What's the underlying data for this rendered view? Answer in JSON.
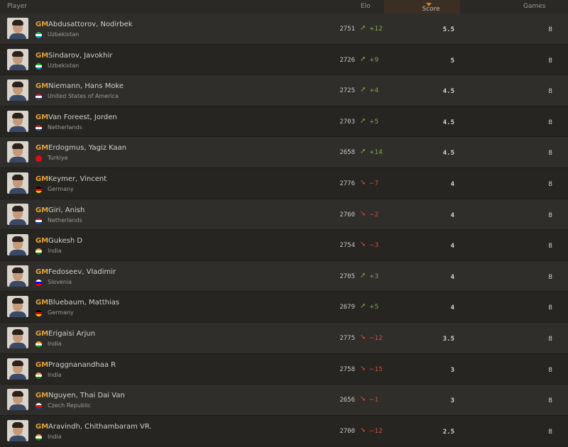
{
  "header": {
    "player": "Player",
    "elo": "Elo",
    "score": "Score",
    "games": "Games"
  },
  "colors": {
    "accent": "#e07a1c",
    "title": "#e2a33a",
    "up": "#7fa650",
    "down": "#d14a3d"
  },
  "players": [
    {
      "title": "GM",
      "name": "Abdusattorov, Nodirbek",
      "country": "Uzbekistan",
      "flag": [
        "#1eb53a",
        "#ffffff",
        "#0099b5"
      ],
      "elo": "2751",
      "dir": "up",
      "delta": "+12",
      "score": "5.5",
      "games": "8"
    },
    {
      "title": "GM",
      "name": "Sindarov, Javokhir",
      "country": "Uzbekistan",
      "flag": [
        "#1eb53a",
        "#ffffff",
        "#0099b5"
      ],
      "elo": "2726",
      "dir": "up",
      "delta": "+9",
      "score": "5",
      "games": "8"
    },
    {
      "title": "GM",
      "name": "Niemann, Hans Moke",
      "country": "United States of America",
      "flag": [
        "#b22234",
        "#ffffff",
        "#3c3b6e"
      ],
      "elo": "2725",
      "dir": "up",
      "delta": "+4",
      "score": "4.5",
      "games": "8"
    },
    {
      "title": "GM",
      "name": "Van Foreest, Jorden",
      "country": "Netherlands",
      "flag": [
        "#ae1c28",
        "#ffffff",
        "#21468b"
      ],
      "elo": "2703",
      "dir": "up",
      "delta": "+5",
      "score": "4.5",
      "games": "8"
    },
    {
      "title": "GM",
      "name": "Erdogmus, Yagiz Kaan",
      "country": "Turkiye",
      "flag": [
        "#e30a17",
        "#e30a17",
        "#e30a17"
      ],
      "elo": "2658",
      "dir": "up",
      "delta": "+14",
      "score": "4.5",
      "games": "8"
    },
    {
      "title": "GM",
      "name": "Keymer, Vincent",
      "country": "Germany",
      "flag": [
        "#000000",
        "#dd0000",
        "#ffce00"
      ],
      "elo": "2776",
      "dir": "down",
      "delta": "−7",
      "score": "4",
      "games": "8"
    },
    {
      "title": "GM",
      "name": "Giri, Anish",
      "country": "Netherlands",
      "flag": [
        "#ae1c28",
        "#ffffff",
        "#21468b"
      ],
      "elo": "2760",
      "dir": "down",
      "delta": "−2",
      "score": "4",
      "games": "8"
    },
    {
      "title": "GM",
      "name": "Gukesh D",
      "country": "India",
      "flag": [
        "#ff9933",
        "#ffffff",
        "#138808"
      ],
      "elo": "2754",
      "dir": "down",
      "delta": "−3",
      "score": "4",
      "games": "8"
    },
    {
      "title": "GM",
      "name": "Fedoseev, Vladimir",
      "country": "Slovenia",
      "flag": [
        "#ffffff",
        "#0000ff",
        "#ff0000"
      ],
      "elo": "2705",
      "dir": "up",
      "delta": "+3",
      "score": "4",
      "games": "8"
    },
    {
      "title": "GM",
      "name": "Bluebaum, Matthias",
      "country": "Germany",
      "flag": [
        "#000000",
        "#dd0000",
        "#ffce00"
      ],
      "elo": "2679",
      "dir": "up",
      "delta": "+5",
      "score": "4",
      "games": "8"
    },
    {
      "title": "GM",
      "name": "Erigaisi Arjun",
      "country": "India",
      "flag": [
        "#ff9933",
        "#ffffff",
        "#138808"
      ],
      "elo": "2775",
      "dir": "down",
      "delta": "−12",
      "score": "3.5",
      "games": "8"
    },
    {
      "title": "GM",
      "name": "Praggnanandhaa R",
      "country": "India",
      "flag": [
        "#ff9933",
        "#ffffff",
        "#138808"
      ],
      "elo": "2758",
      "dir": "down",
      "delta": "−15",
      "score": "3",
      "games": "8"
    },
    {
      "title": "GM",
      "name": "Nguyen, Thai Dai Van",
      "country": "Czech Republic",
      "flag": [
        "#ffffff",
        "#d7141a",
        "#11457e"
      ],
      "elo": "2656",
      "dir": "down",
      "delta": "−1",
      "score": "3",
      "games": "8"
    },
    {
      "title": "GM",
      "name": "Aravindh, Chithambaram VR.",
      "country": "India",
      "flag": [
        "#ff9933",
        "#ffffff",
        "#138808"
      ],
      "elo": "2700",
      "dir": "down",
      "delta": "−12",
      "score": "2.5",
      "games": "8"
    }
  ]
}
